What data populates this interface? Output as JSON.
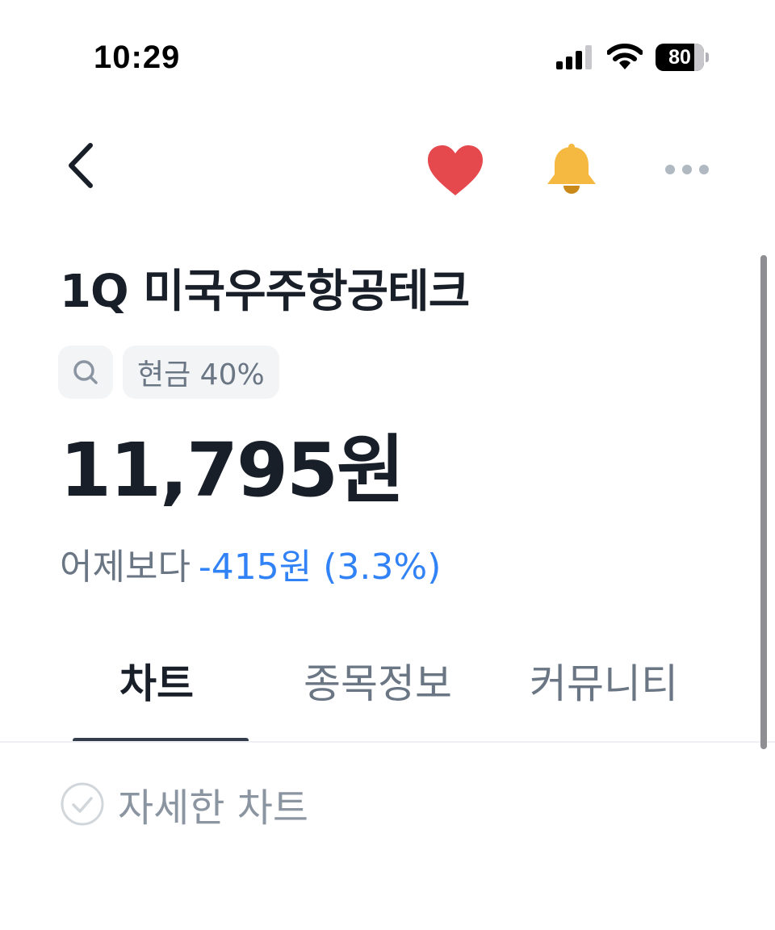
{
  "status_bar": {
    "time": "10:29",
    "battery_text": "80",
    "battery_level": 0.8,
    "icons": [
      "signal-icon",
      "wifi-icon",
      "battery-icon"
    ]
  },
  "nav": {
    "icons": [
      "back-chevron-icon",
      "heart-icon",
      "bell-icon",
      "more-icon"
    ],
    "heart_color": "#e5484d",
    "bell_color": "#f5b942"
  },
  "stock": {
    "name": "1Q 미국우주항공테크",
    "tag_label": "현금 40%",
    "price": "11,795원",
    "change_label": "어제보다",
    "change_value": "-415원 (3.3%)",
    "change_color": "#3182f6"
  },
  "tabs": [
    {
      "label": "차트",
      "active": true
    },
    {
      "label": "종목정보",
      "active": false
    },
    {
      "label": "커뮤니티",
      "active": false
    }
  ],
  "detail_chart": {
    "label": "자세한 차트",
    "checked": false
  },
  "colors": {
    "text_primary": "#191f28",
    "text_secondary": "#6b7684",
    "text_tertiary": "#8b95a1",
    "accent_blue": "#3182f6",
    "chip_bg": "#f2f4f6"
  }
}
